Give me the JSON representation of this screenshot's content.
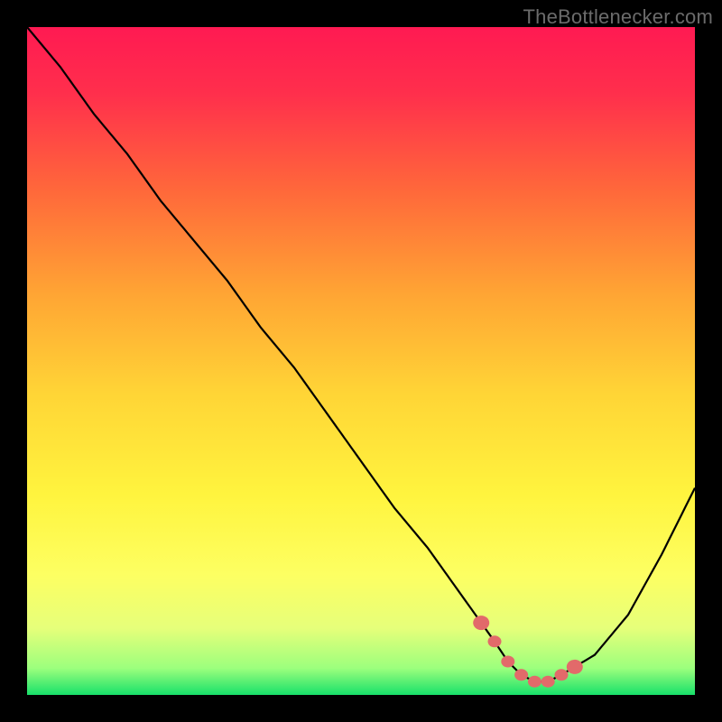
{
  "attribution": "TheBottlenecker.com",
  "gradient_stops": [
    {
      "offset": 0.0,
      "color": "#ff1a52"
    },
    {
      "offset": 0.1,
      "color": "#ff2f4c"
    },
    {
      "offset": 0.25,
      "color": "#ff6a3a"
    },
    {
      "offset": 0.4,
      "color": "#ffa534"
    },
    {
      "offset": 0.55,
      "color": "#ffd536"
    },
    {
      "offset": 0.7,
      "color": "#fff43e"
    },
    {
      "offset": 0.82,
      "color": "#fdff62"
    },
    {
      "offset": 0.9,
      "color": "#e6ff7a"
    },
    {
      "offset": 0.96,
      "color": "#9cff7d"
    },
    {
      "offset": 1.0,
      "color": "#18e06a"
    }
  ],
  "marker_color": "#e26a6a",
  "chart_data": {
    "type": "line",
    "title": "",
    "xlabel": "",
    "ylabel": "",
    "x": [
      0,
      5,
      10,
      15,
      20,
      25,
      30,
      35,
      40,
      45,
      50,
      55,
      60,
      65,
      70,
      72,
      74,
      76,
      78,
      80,
      85,
      90,
      95,
      100
    ],
    "values": [
      100,
      94,
      87,
      81,
      74,
      68,
      62,
      55,
      49,
      42,
      35,
      28,
      22,
      15,
      8,
      5,
      3,
      2,
      2,
      3,
      6,
      12,
      21,
      31
    ],
    "xlim": [
      0,
      100
    ],
    "ylim": [
      0,
      100
    ],
    "marker_points_x": [
      68,
      70,
      72,
      74,
      76,
      78,
      80,
      82
    ]
  }
}
